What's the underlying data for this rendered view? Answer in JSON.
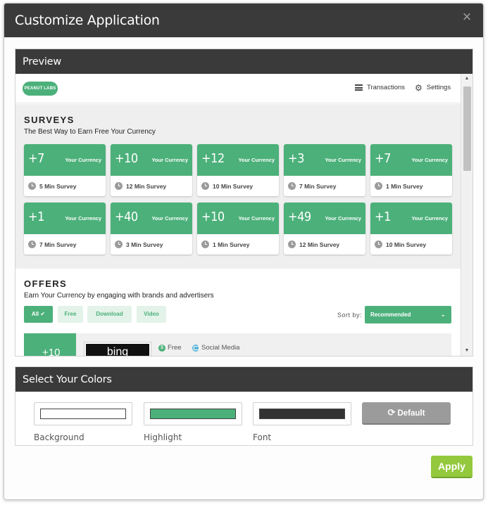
{
  "modal": {
    "title": "Customize Application",
    "close_glyph": "×"
  },
  "preview": {
    "header": "Preview",
    "app": {
      "logo_text": "PEANUT LABS",
      "nav": {
        "transactions": "Transactions",
        "settings": "Settings"
      },
      "surveys": {
        "title": "SURVEYS",
        "subtitle": "The Best Way to Earn Free Your Currency",
        "cards": [
          {
            "amount": "+7",
            "currency": "Your Currency",
            "duration": "5 Min Survey"
          },
          {
            "amount": "+10",
            "currency": "Your Currency",
            "duration": "12 Min Survey"
          },
          {
            "amount": "+12",
            "currency": "Your Currency",
            "duration": "10 Min Survey"
          },
          {
            "amount": "+3",
            "currency": "Your Currency",
            "duration": "7 Min Survey"
          },
          {
            "amount": "+7",
            "currency": "Your Currency",
            "duration": "1 Min Survey"
          },
          {
            "amount": "+1",
            "currency": "Your Currency",
            "duration": "7 Min Survey"
          },
          {
            "amount": "+40",
            "currency": "Your Currency",
            "duration": "3 Min Survey"
          },
          {
            "amount": "+10",
            "currency": "Your Currency",
            "duration": "1 Min Survey"
          },
          {
            "amount": "+49",
            "currency": "Your Currency",
            "duration": "12 Min Survey"
          },
          {
            "amount": "+1",
            "currency": "Your Currency",
            "duration": "10 Min Survey"
          }
        ]
      },
      "offers": {
        "title": "OFFERS",
        "subtitle": "Earn Your Currency by engaging with brands and advertisers",
        "filters": [
          "All ✔",
          "Free",
          "Download",
          "Video"
        ],
        "sort_label": "Sort by:",
        "sort_value": "Recommended",
        "first_offer": {
          "amount": "+10",
          "logo_text": "bing",
          "tags": [
            "Free",
            "Social Media"
          ]
        }
      }
    }
  },
  "colors": {
    "header": "Select Your Colors",
    "background": {
      "label": "Background",
      "value": "#ffffff"
    },
    "highlight": {
      "label": "Highlight",
      "value": "#4cb07a"
    },
    "font": {
      "label": "Font",
      "value": "#333333"
    },
    "default_button": "Default"
  },
  "apply_button": "Apply",
  "icons": {
    "close": "close-icon",
    "menu": "hamburger-icon",
    "settings": "gear-icon",
    "clock": "clock-icon",
    "refresh": "refresh-icon"
  }
}
